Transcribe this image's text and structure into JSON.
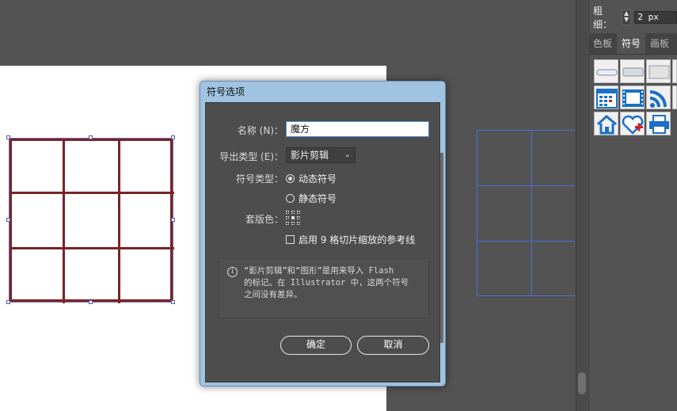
{
  "panel": {
    "stroke_label": "粗细：",
    "stroke_value": "2 px",
    "tabs": [
      {
        "label": "色板",
        "active": false
      },
      {
        "label": "符号",
        "active": true
      },
      {
        "label": "画板",
        "active": false
      }
    ],
    "symbols": [
      "button-flat-icon",
      "button-gradient-icon",
      "button-plain-icon",
      "button-partial-icon",
      "calendar-icon",
      "film-icon",
      "rss-icon",
      "partial-icon",
      "home-icon",
      "heart-plus-icon",
      "printer-icon"
    ]
  },
  "dialog": {
    "title": "符号选项",
    "name_label": "名称 (N)：",
    "name_value": "魔方",
    "export_label": "导出类型 (E)：",
    "export_value": "影片剪辑",
    "type_label": "符号类型：",
    "radio_dynamic": "动态符号",
    "radio_static": "静态符号",
    "registration_label": "套版色：",
    "registration_icon": "registration-grid-icon",
    "checkbox_label": "启用 9 格切片缩放的参考线",
    "info_text": "“影片剪辑”和“图形”是用来导入 Flash\n的标记。在 Illustrator 中，这两个符号\n之间没有差异。",
    "ok_label": "确定",
    "cancel_label": "取消"
  },
  "colors": {
    "workspace": "#535353",
    "artboard": "#ffffff",
    "cube_line": "#7a2325",
    "guide_line": "#4b6fd6",
    "dialog_frame": "#9fc3e0"
  }
}
